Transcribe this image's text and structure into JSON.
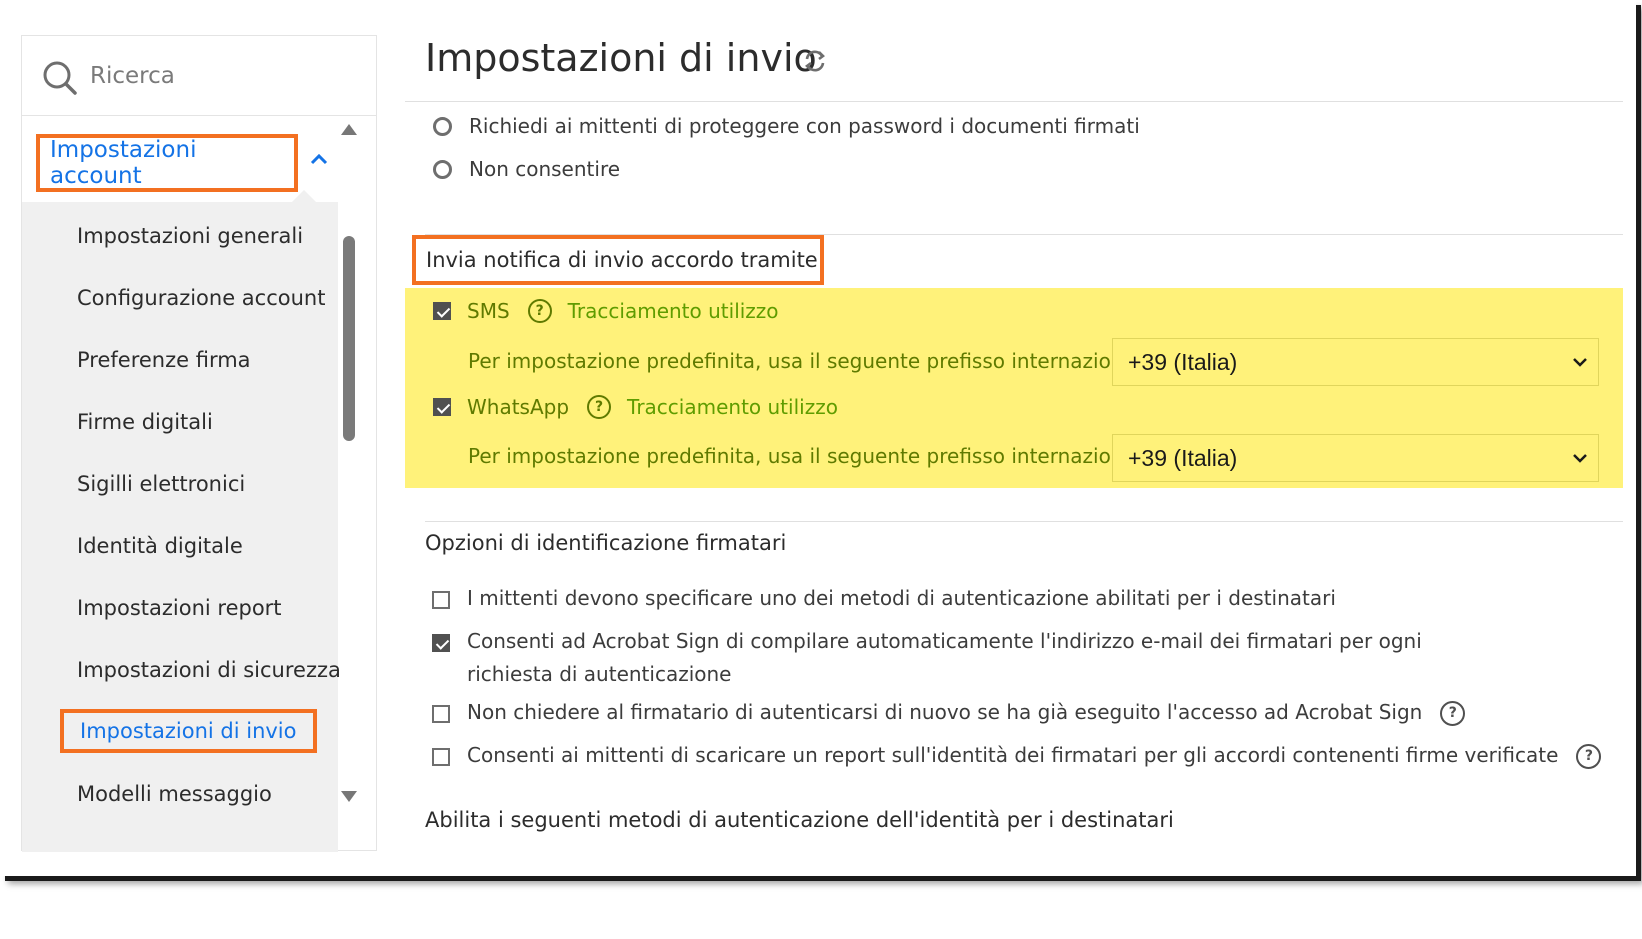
{
  "search": {
    "placeholder": "Ricerca"
  },
  "sidebar": {
    "section_label": "Impostazioni account",
    "items": [
      {
        "label": "Impostazioni generali"
      },
      {
        "label": "Configurazione account"
      },
      {
        "label": "Preferenze firma"
      },
      {
        "label": "Firme digitali"
      },
      {
        "label": "Sigilli elettronici"
      },
      {
        "label": "Identità digitale"
      },
      {
        "label": "Impostazioni report"
      },
      {
        "label": "Impostazioni di sicurezza"
      },
      {
        "label": "Impostazioni di invio"
      },
      {
        "label": "Modelli messaggio"
      }
    ],
    "active_item": "Impostazioni di invio"
  },
  "main": {
    "title": "Impostazioni di invio",
    "password_options": [
      {
        "label": "Richiedi ai mittenti di proteggere con password i documenti firmati",
        "selected": false
      },
      {
        "label": "Non consentire",
        "selected": false
      }
    ],
    "notification": {
      "heading": "Invia notifica di invio accordo tramite",
      "channels": [
        {
          "label": "SMS",
          "checked": true,
          "tracking_label": "Tracciamento utilizzo",
          "prefix_label": "Per impostazione predefinita, usa il seguente prefisso internazionale:",
          "prefix_value": "+39 (Italia)"
        },
        {
          "label": "WhatsApp",
          "checked": true,
          "tracking_label": "Tracciamento utilizzo",
          "prefix_label": "Per impostazione predefinita, usa il seguente prefisso internazionale:",
          "prefix_value": "+39 (Italia)"
        }
      ]
    },
    "identification": {
      "heading": "Opzioni di identificazione firmatari",
      "options": [
        {
          "label": "I mittenti devono specificare uno dei metodi di autenticazione abilitati per i destinatari",
          "checked": false
        },
        {
          "label": "Consenti ad Acrobat Sign di compilare automaticamente l'indirizzo e-mail dei firmatari per ogni richiesta di autenticazione",
          "checked": true
        },
        {
          "label": "Non chiedere al firmatario di autenticarsi di nuovo se ha già eseguito l'accesso ad Acrobat Sign",
          "checked": false
        },
        {
          "label": "Consenti ai mittenti di scaricare un report sull'identità dei firmatari per gli accordi contenenti firme verificate",
          "checked": false
        }
      ]
    },
    "auth_heading": "Abilita i seguenti metodi di autenticazione dell'identità per i destinatari"
  },
  "colors": {
    "accent": "#1473e6",
    "highlight_border": "#f37021",
    "highlight_fill": "#fff27a",
    "link_green": "#5f9c00"
  },
  "icons": {
    "search": "search-icon",
    "refresh": "refresh-icon",
    "chevron_up": "chevron-up-icon",
    "chevron_down": "chevron-down-icon",
    "help": "help-icon"
  },
  "help_glyph": "?"
}
